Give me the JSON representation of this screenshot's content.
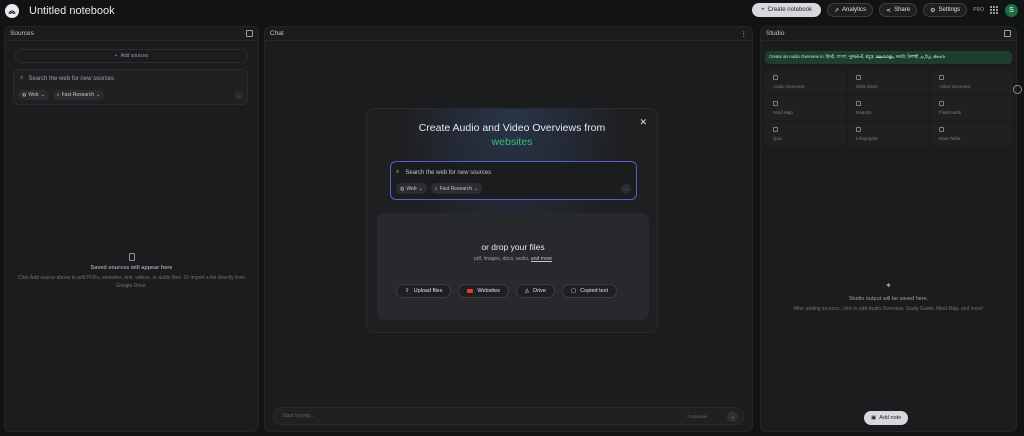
{
  "header": {
    "title": "Untitled notebook",
    "create_notebook": "Create notebook",
    "analytics": "Analytics",
    "share": "Share",
    "settings": "Settings",
    "pro": "PRO",
    "avatar_letter": "S"
  },
  "sources": {
    "title": "Sources",
    "add_sources": "Add sources",
    "search_placeholder": "Search the web for new sources",
    "chip_web": "Web",
    "chip_research": "Fast Research",
    "empty_title": "Saved sources will appear here",
    "empty_desc": "Click Add source above to add PDFs, websites, text, videos, or audio files. Or import a file directly from Google Drive."
  },
  "chat": {
    "title": "Chat",
    "input_placeholder": "Start typing...",
    "source_count": "0 sources"
  },
  "modal": {
    "title_line1": "Create Audio and Video Overviews from",
    "title_highlight": "websites",
    "search_placeholder": "Search the web for new sources",
    "chip_web": "Web",
    "chip_research": "Fast Research",
    "drop_title": "or drop your files",
    "drop_subtitle": "pdf, images, docs, audio,",
    "drop_more": "and more",
    "btn_upload": "Upload files",
    "btn_websites": "Websites",
    "btn_drive": "Drive",
    "btn_copied": "Copied text"
  },
  "studio": {
    "title": "Studio",
    "banner": "Create an Audio Overview in: हिन्दी, বাংলা, ગુજરાતી, ಕನ್ನಡ, മലയാളം, मराठी, ਪੰਜਾਬੀ, தமிழ், తెలుగు",
    "tools": [
      "Audio Overview",
      "Slide Deck",
      "Video Overview",
      "Mind Map",
      "Reports",
      "Flashcards",
      "Quiz",
      "Infographic",
      "Data Table"
    ],
    "empty_title": "Studio output will be saved here.",
    "empty_desc": "After adding sources, click to add Audio Overview, Study Guide, Mind Map, and more!",
    "add_note": "Add note"
  }
}
